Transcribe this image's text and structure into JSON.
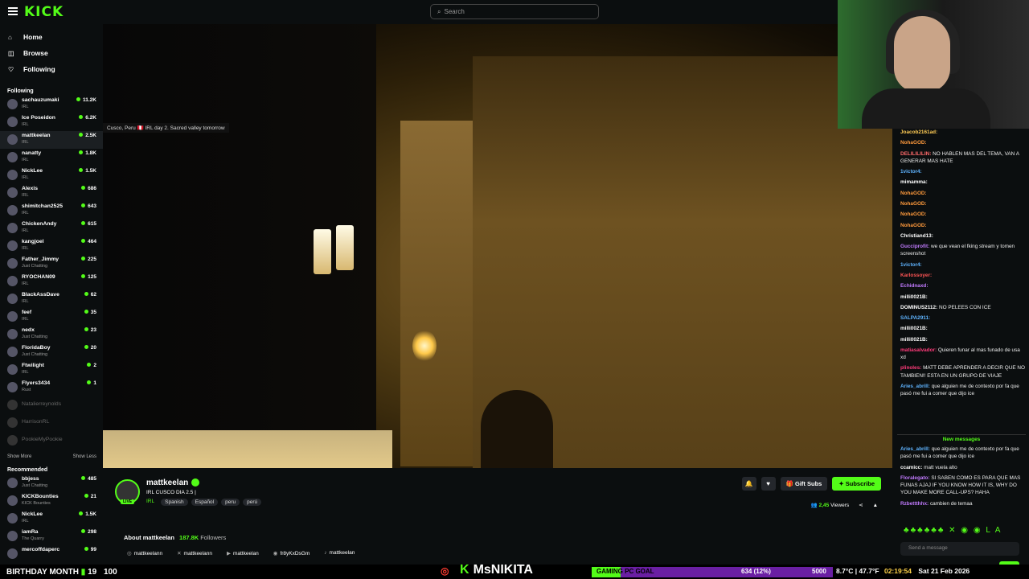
{
  "header": {
    "logo": "KICK",
    "search_placeholder": "Search"
  },
  "nav": [
    {
      "label": "Home",
      "icon": "home-icon",
      "glyph": "⌂"
    },
    {
      "label": "Browse",
      "icon": "compass-icon",
      "glyph": "◫"
    },
    {
      "label": "Following",
      "icon": "heart-icon",
      "glyph": "♡"
    }
  ],
  "sidebar": {
    "following_label": "Following",
    "following": [
      {
        "name": "sachauzumaki",
        "category": "IRL",
        "viewers": "11.2K"
      },
      {
        "name": "Ice Poseidon",
        "category": "IRL",
        "viewers": "6.2K"
      },
      {
        "name": "mattkeelan",
        "category": "IRL",
        "viewers": "2.5K"
      },
      {
        "name": "nanatty",
        "category": "IRL",
        "viewers": "1.8K"
      },
      {
        "name": "NickLee",
        "category": "IRL",
        "viewers": "1.5K"
      },
      {
        "name": "Alexis",
        "category": "IRL",
        "viewers": "686"
      },
      {
        "name": "shimitchan2525",
        "category": "IRL",
        "viewers": "643"
      },
      {
        "name": "ChickenAndy",
        "category": "IRL",
        "viewers": "615"
      },
      {
        "name": "kangjoel",
        "category": "IRL",
        "viewers": "464"
      },
      {
        "name": "Father_Jimmy",
        "category": "Just Chatting",
        "viewers": "225"
      },
      {
        "name": "RYOCHAN09",
        "category": "IRL",
        "viewers": "125"
      },
      {
        "name": "BlackAssDave",
        "category": "IRL",
        "viewers": "62"
      },
      {
        "name": "feef",
        "category": "IRL",
        "viewers": "35"
      },
      {
        "name": "nedx",
        "category": "Just Chatting",
        "viewers": "23"
      },
      {
        "name": "FloridaBoy",
        "category": "Just Chatting",
        "viewers": "20"
      },
      {
        "name": "Ftwilight",
        "category": "IRL",
        "viewers": "2"
      },
      {
        "name": "Flyers3434",
        "category": "Rust",
        "viewers": "1"
      }
    ],
    "offline": [
      "Natalierreynolds",
      "HarrisonRL",
      "PookieMyPookie"
    ],
    "show_more": "Show More",
    "show_less": "Show Less",
    "recommended_label": "Recommended",
    "recommended": [
      {
        "name": "bbjess",
        "category": "Just Chatting",
        "viewers": "485"
      },
      {
        "name": "KICKBounties",
        "category": "KICK Bounties",
        "viewers": "21"
      },
      {
        "name": "NickLee",
        "category": "IRL",
        "viewers": "1.5K"
      },
      {
        "name": "iamRa",
        "category": "The Quarry",
        "viewers": "298"
      },
      {
        "name": "mercoffdaperc",
        "category": "",
        "viewers": "99"
      }
    ]
  },
  "video": {
    "tooltip": "Cusco, Peru 🇵🇪 IRL day 2. Sacred valley tomorrow"
  },
  "stream": {
    "name": "mattkeelan",
    "live_badge": "LIVE",
    "title": "IRL CUSCO DIA 2.5 |",
    "category": "IRL",
    "tags": [
      "Spanish",
      "Español",
      "peru",
      "perú"
    ],
    "gift_label": "Gift Subs",
    "subscribe_label": "Subscribe",
    "viewers": "2,45",
    "viewers_label": "Viewers",
    "about_label": "About mattkeelan",
    "followers_count": "187.8K",
    "followers_label": "Followers",
    "socials": [
      {
        "icon": "instagram-icon",
        "glyph": "◎",
        "handle": "mattkeelann"
      },
      {
        "icon": "x-icon",
        "glyph": "✕",
        "handle": "mattkeelann"
      },
      {
        "icon": "youtube-icon",
        "glyph": "▶",
        "handle": "mattkeelan"
      },
      {
        "icon": "discord-icon",
        "glyph": "◉",
        "handle": "fr8yKxDsGm"
      },
      {
        "icon": "tiktok-icon",
        "glyph": "♪",
        "handle": "mattkeelan"
      }
    ]
  },
  "chat": {
    "messages": [
      {
        "user": "Joacob2161ad:",
        "text": "",
        "color": "#ffcc55"
      },
      {
        "user": "NohaGOD:",
        "text": "",
        "color": "#ff9a3c"
      },
      {
        "user": "DELILILILIN:",
        "text": "NO HABLEN MAS DEL TEMA, VAN A GENERAR MAS HATE",
        "color": "#ff6b6b"
      },
      {
        "user": "1victor4:",
        "text": "",
        "color": "#5fb4ff"
      },
      {
        "user": "mimamma:",
        "text": "",
        "color": "#ffffff"
      },
      {
        "user": "NohaGOD:",
        "text": "",
        "color": "#ff9a3c"
      },
      {
        "user": "NohaGOD:",
        "text": "",
        "color": "#ff9a3c"
      },
      {
        "user": "NohaGOD:",
        "text": "",
        "color": "#ff9a3c"
      },
      {
        "user": "NohaGOD:",
        "text": "",
        "color": "#ff9a3c"
      },
      {
        "user": "Christiand13:",
        "text": "",
        "color": "#ffffff"
      },
      {
        "user": "Gucciprofit:",
        "text": "we que vean el fking stream y tomen screenshot",
        "color": "#c27bff"
      },
      {
        "user": "1victor4:",
        "text": "",
        "color": "#5fb4ff"
      },
      {
        "user": "Karlossoyer:",
        "text": "",
        "color": "#ff5555"
      },
      {
        "user": "Echidnaxd:",
        "text": "",
        "color": "#c27bff"
      },
      {
        "user": "milli0021B:",
        "text": "",
        "color": "#ffffff"
      },
      {
        "user": "DOMINUS2112:",
        "text": "NO PELEES CON ICE",
        "color": "#ffffff"
      },
      {
        "user": "SALPA2911:",
        "text": "",
        "color": "#5fb4ff"
      },
      {
        "user": "milli0021B:",
        "text": "",
        "color": "#ffffff"
      },
      {
        "user": "milli0021B:",
        "text": "",
        "color": "#ffffff"
      },
      {
        "user": "matiasalvador:",
        "text": "Quieren funar al mas funado de usa xd",
        "color": "#ff3b7a"
      },
      {
        "user": "plinoles:",
        "text": "MATT DEBE APRENDER A DECIR QUE NO TAMBIEN!! ESTA EN UN GRUPO DE VIAJE",
        "color": "#ff3b7a"
      },
      {
        "user": "Aries_abrill:",
        "text": "que alguien me de contexto por fa que pasó me fui a comer que dijo ice",
        "color": "#5fb4ff"
      }
    ],
    "new_messages_label": "New messages",
    "after_messages": [
      {
        "user": "Aries_abrill:",
        "text": "que alguien me de contexto por fa que pasó me fui a comer que dijo ice",
        "color": "#5fb4ff"
      },
      {
        "user": "ccamicc:",
        "text": "matt vuela alto",
        "color": "#ffffff"
      },
      {
        "user": "Floralegato:",
        "text": "SI SABEN COMO ES PARA QUE MAS FUNAS AJAJ IF YOU KNOW HOW IT IS, WHY DO YOU MAKE MORE CALL-UPS? HAHA",
        "color": "#c27bff"
      },
      {
        "user": "Rzbettthhx:",
        "text": "cambien de temaa",
        "color": "#c27bff"
      }
    ],
    "emote_bar": "♣♣♣♣♣♣ ✕ ◉ ◉ L A",
    "input_placeholder": "Send a message"
  },
  "overlay": {
    "birthday_label": "BIRTHDAY MONTH",
    "birthday_count": "19",
    "birthday_total": "100",
    "kick_name": "MsNIKITA",
    "goal_label": "GAMING PC GOAL",
    "goal_progress": "634 (12%)",
    "goal_fraction": 0.12,
    "goal_target": "5000",
    "weather": "8.7°C | 47.7°F",
    "time": "02:19:54",
    "date": "Sat 21 Feb 2026"
  },
  "colors": {
    "accent": "#53fc18",
    "goal_bg": "#6a1fa3"
  }
}
